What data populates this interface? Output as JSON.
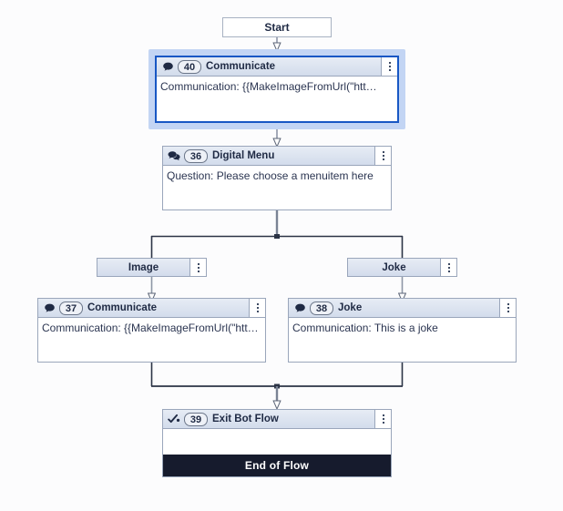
{
  "canvas": {
    "background": "#fcfcfd",
    "edge_color": "#5d6678",
    "selection_halo_color": "#c3d5f4",
    "selection_border_color": "#1857c4"
  },
  "start": {
    "label": "Start"
  },
  "nodes": [
    {
      "id": "40",
      "title": "Communicate",
      "icon": "speech-bubble-icon",
      "body": "Communication: {{MakeImageFromUrl(\"htt…",
      "menu_icon": "kebab-menu-icon",
      "selected": true
    },
    {
      "id": "36",
      "title": "Digital Menu",
      "icon": "double-speech-bubble-icon",
      "body": "Question: Please choose a menuitem here",
      "menu_icon": "kebab-menu-icon",
      "selected": false
    },
    {
      "id": "37",
      "title": "Communicate",
      "icon": "speech-bubble-icon",
      "body": "Communication: {{MakeImageFromUrl(\"htt…",
      "menu_icon": "kebab-menu-icon",
      "selected": false
    },
    {
      "id": "38",
      "title": "Joke",
      "icon": "speech-bubble-icon",
      "body": "Communication: This is a joke",
      "menu_icon": "kebab-menu-icon",
      "selected": false
    },
    {
      "id": "39",
      "title": "Exit Bot Flow",
      "icon": "exit-flow-icon",
      "body": "",
      "menu_icon": "kebab-menu-icon",
      "footer": "End of Flow",
      "selected": false
    }
  ],
  "branches": [
    {
      "label": "Image",
      "menu_icon": "kebab-menu-icon"
    },
    {
      "label": "Joke",
      "menu_icon": "kebab-menu-icon"
    }
  ]
}
